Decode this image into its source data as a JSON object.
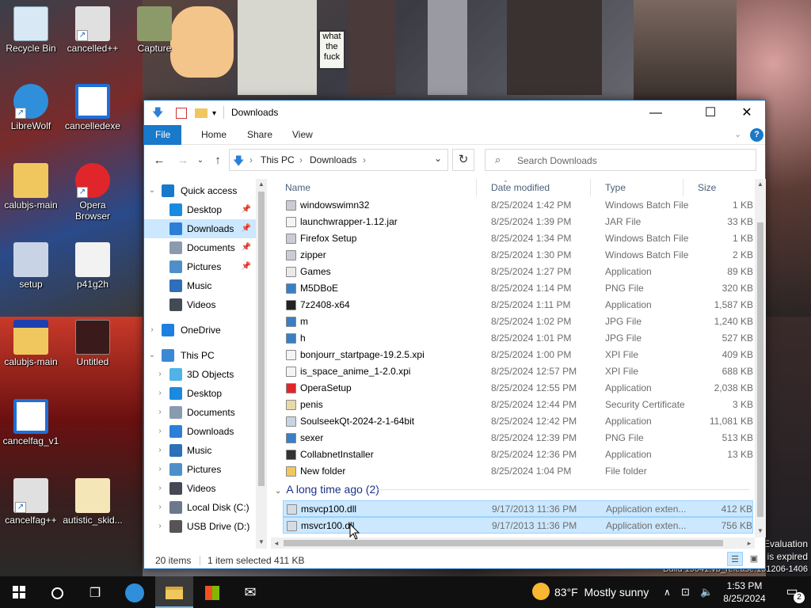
{
  "desktop": {
    "icons": [
      {
        "label": "Recycle Bin",
        "icon": "recycle-bin-icon",
        "color": "#d9e8f5"
      },
      {
        "label": "cancelled++",
        "icon": "settings-file-icon",
        "color": "#e0e0e0"
      },
      {
        "label": "Capture",
        "icon": "image-file-icon",
        "color": "#8c9a6a"
      },
      {
        "label": "LibreWolf",
        "icon": "librewolf-icon",
        "color": "#2f8fdb"
      },
      {
        "label": "cancelledexe",
        "icon": "app-window-icon",
        "color": "#1e6fd9"
      },
      {
        "label": "calubjs-main",
        "icon": "folder-icon",
        "color": "#f0c75e"
      },
      {
        "label": "Opera Browser",
        "icon": "opera-icon",
        "color": "#e0262a"
      },
      {
        "label": "setup",
        "icon": "installer-icon",
        "color": "#c8d4e6"
      },
      {
        "label": "p41g2h",
        "icon": "image-file-icon",
        "color": "#f2f2f2"
      },
      {
        "label": "calubjs-main",
        "icon": "zip-folder-icon",
        "color": "#f0c75e"
      },
      {
        "label": "Untitled",
        "icon": "image-file-icon",
        "color": "#3a1a1a"
      },
      {
        "label": "cancelfag_v1",
        "icon": "app-window-icon",
        "color": "#1e6fd9"
      },
      {
        "label": "cancelfag++",
        "icon": "settings-file-icon",
        "color": "#e0e0e0"
      },
      {
        "label": "autistic_skid...",
        "icon": "file-icon",
        "color": "#f5e6b8"
      }
    ],
    "wallpaper_text": [
      "what",
      "the",
      "fuck"
    ],
    "watermark": [
      "Evaluation",
      "is expired",
      "Build 19041.vb_release.191206-1406"
    ]
  },
  "explorer": {
    "title": "Downloads",
    "caption_buttons": {
      "minimize": "—",
      "maximize": "☐",
      "close": "✕"
    },
    "ribbon_tabs": [
      "File",
      "Home",
      "Share",
      "View"
    ],
    "help": "?",
    "address": {
      "root": "This PC",
      "folder": "Downloads"
    },
    "search_placeholder": "Search Downloads",
    "nav_pane": [
      {
        "label": "Quick access",
        "icon": "star-icon",
        "color": "#1979ca",
        "level": 0,
        "chev": "⌄",
        "pinned": false
      },
      {
        "label": "Desktop",
        "icon": "desktop-icon",
        "color": "#1a8ae0",
        "level": 1,
        "chev": "",
        "pinned": true
      },
      {
        "label": "Downloads",
        "icon": "download-icon",
        "color": "#2d7fd6",
        "level": 1,
        "chev": "",
        "pinned": true,
        "selected": true
      },
      {
        "label": "Documents",
        "icon": "document-icon",
        "color": "#8a9bb0",
        "level": 1,
        "chev": "",
        "pinned": true
      },
      {
        "label": "Pictures",
        "icon": "pictures-icon",
        "color": "#4f8fc9",
        "level": 1,
        "chev": "",
        "pinned": true
      },
      {
        "label": "Music",
        "icon": "music-icon",
        "color": "#2d6fb8",
        "level": 1,
        "chev": "",
        "pinned": false
      },
      {
        "label": "Videos",
        "icon": "videos-icon",
        "color": "#444a55",
        "level": 1,
        "chev": "",
        "pinned": false
      },
      {
        "label": "OneDrive",
        "icon": "cloud-icon",
        "color": "#1f7fe0",
        "level": 0,
        "chev": "›",
        "pinned": false
      },
      {
        "label": "This PC",
        "icon": "computer-icon",
        "color": "#3b88d4",
        "level": 0,
        "chev": "⌄",
        "pinned": false
      },
      {
        "label": "3D Objects",
        "icon": "cube-icon",
        "color": "#4fb3e8",
        "level": 1,
        "chev": "›",
        "pinned": false
      },
      {
        "label": "Desktop",
        "icon": "desktop-icon",
        "color": "#1a8ae0",
        "level": 1,
        "chev": "›",
        "pinned": false
      },
      {
        "label": "Documents",
        "icon": "document-icon",
        "color": "#8a9bb0",
        "level": 1,
        "chev": "›",
        "pinned": false
      },
      {
        "label": "Downloads",
        "icon": "download-icon",
        "color": "#2d7fd6",
        "level": 1,
        "chev": "›",
        "pinned": false
      },
      {
        "label": "Music",
        "icon": "music-icon",
        "color": "#2d6fb8",
        "level": 1,
        "chev": "›",
        "pinned": false
      },
      {
        "label": "Pictures",
        "icon": "pictures-icon",
        "color": "#4f8fc9",
        "level": 1,
        "chev": "›",
        "pinned": false
      },
      {
        "label": "Videos",
        "icon": "videos-icon",
        "color": "#444a55",
        "level": 1,
        "chev": "›",
        "pinned": false
      },
      {
        "label": "Local Disk (C:)",
        "icon": "drive-icon",
        "color": "#6b7a8a",
        "level": 1,
        "chev": "›",
        "pinned": false
      },
      {
        "label": "USB Drive (D:)",
        "icon": "usb-drive-icon",
        "color": "#555555",
        "level": 1,
        "chev": "›",
        "pinned": false
      }
    ],
    "columns": [
      "Name",
      "Date modified",
      "Type",
      "Size"
    ],
    "files": [
      {
        "name": "windowswimn32",
        "date": "8/25/2024 1:42 PM",
        "type": "Windows Batch File",
        "size": "1 KB",
        "icon": "batch-file-icon",
        "color": "#c9cdd3"
      },
      {
        "name": "launchwrapper-1.12.jar",
        "date": "8/25/2024 1:39 PM",
        "type": "JAR File",
        "size": "33 KB",
        "icon": "file-icon",
        "color": "#f4f4f4"
      },
      {
        "name": "Firefox Setup",
        "date": "8/25/2024 1:34 PM",
        "type": "Windows Batch File",
        "size": "1 KB",
        "icon": "batch-file-icon",
        "color": "#c9cdd3"
      },
      {
        "name": "zipper",
        "date": "8/25/2024 1:30 PM",
        "type": "Windows Batch File",
        "size": "2 KB",
        "icon": "batch-file-icon",
        "color": "#c9cdd3"
      },
      {
        "name": "Games",
        "date": "8/25/2024 1:27 PM",
        "type": "Application",
        "size": "89 KB",
        "icon": "application-icon",
        "color": "#e9e9e9"
      },
      {
        "name": "M5DBoE",
        "date": "8/25/2024 1:14 PM",
        "type": "PNG File",
        "size": "320 KB",
        "icon": "image-file-icon",
        "color": "#3a7fc4"
      },
      {
        "name": "7z2408-x64",
        "date": "8/25/2024 1:11 PM",
        "type": "Application",
        "size": "1,587 KB",
        "icon": "7zip-icon",
        "color": "#222222"
      },
      {
        "name": "m",
        "date": "8/25/2024 1:02 PM",
        "type": "JPG File",
        "size": "1,240 KB",
        "icon": "image-file-icon",
        "color": "#3a7fc4"
      },
      {
        "name": "h",
        "date": "8/25/2024 1:01 PM",
        "type": "JPG File",
        "size": "527 KB",
        "icon": "image-file-icon",
        "color": "#3a7fc4"
      },
      {
        "name": "bonjourr_startpage-19.2.5.xpi",
        "date": "8/25/2024 1:00 PM",
        "type": "XPI File",
        "size": "409 KB",
        "icon": "file-icon",
        "color": "#f4f4f4"
      },
      {
        "name": "is_space_anime_1-2.0.xpi",
        "date": "8/25/2024 12:57 PM",
        "type": "XPI File",
        "size": "688 KB",
        "icon": "file-icon",
        "color": "#f4f4f4"
      },
      {
        "name": "OperaSetup",
        "date": "8/25/2024 12:55 PM",
        "type": "Application",
        "size": "2,038 KB",
        "icon": "opera-icon",
        "color": "#e0262a"
      },
      {
        "name": "penis",
        "date": "8/25/2024 12:44 PM",
        "type": "Security Certificate",
        "size": "3 KB",
        "icon": "certificate-icon",
        "color": "#e8d9a8"
      },
      {
        "name": "SoulseekQt-2024-2-1-64bit",
        "date": "8/25/2024 12:42 PM",
        "type": "Application",
        "size": "11,081 KB",
        "icon": "installer-icon",
        "color": "#c8d4e6"
      },
      {
        "name": "sexer",
        "date": "8/25/2024 12:39 PM",
        "type": "PNG File",
        "size": "513 KB",
        "icon": "image-file-icon",
        "color": "#3a7fc4"
      },
      {
        "name": "CollabnetInstaller",
        "date": "8/25/2024 12:36 PM",
        "type": "Application",
        "size": "13 KB",
        "icon": "application-icon",
        "color": "#333333"
      },
      {
        "name": "New folder",
        "date": "8/25/2024 1:04 PM",
        "type": "File folder",
        "size": "",
        "icon": "folder-icon",
        "color": "#f0c75e"
      }
    ],
    "group_header": "A long time ago (2)",
    "old_files": [
      {
        "name": "msvcp100.dll",
        "date": "9/17/2013 11:36 PM",
        "type": "Application exten...",
        "size": "412 KB",
        "icon": "dll-file-icon",
        "color": "#d6dbe2"
      },
      {
        "name": "msvcr100.dll",
        "date": "9/17/2013 11:36 PM",
        "type": "Application exten...",
        "size": "756 KB",
        "icon": "dll-file-icon",
        "color": "#d6dbe2"
      }
    ],
    "status": {
      "count": "20 items",
      "selected": "1 item selected",
      "size": "411 KB"
    }
  },
  "taskbar": {
    "weather": {
      "temp": "83°F",
      "condition": "Mostly sunny"
    },
    "time": "1:53 PM",
    "date": "8/25/2024",
    "notification_count": "2"
  }
}
